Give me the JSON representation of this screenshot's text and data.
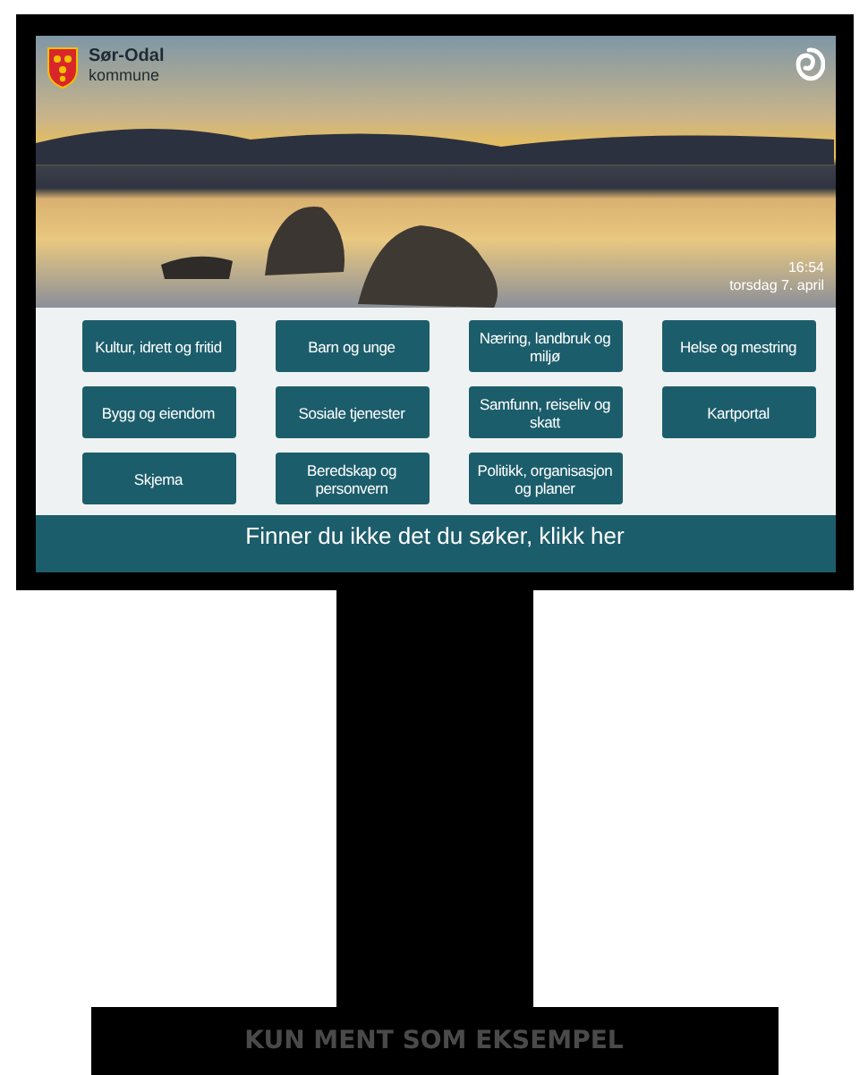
{
  "header": {
    "municipality": "Sør-Odal",
    "subtitle": "kommune",
    "time": "16:54",
    "date": "torsdag 7. april"
  },
  "menu_buttons": [
    {
      "label": "Kultur, idrett og fritid"
    },
    {
      "label": "Barn og unge"
    },
    {
      "label": "Næring, landbruk og miljø"
    },
    {
      "label": "Helse og mestring"
    },
    {
      "label": "Bygg og eiendom"
    },
    {
      "label": "Sosiale tjenester"
    },
    {
      "label": "Samfunn, reiseliv og skatt"
    },
    {
      "label": "Kartportal"
    },
    {
      "label": "Skjema"
    },
    {
      "label": "Beredskap og personvern"
    },
    {
      "label": "Politikk, organisasjon og planer"
    }
  ],
  "footer": {
    "link": "Finner du ikke det du søker, klikk her"
  },
  "stand": {
    "label": "KUN MENT SOM EKSEMPEL"
  }
}
